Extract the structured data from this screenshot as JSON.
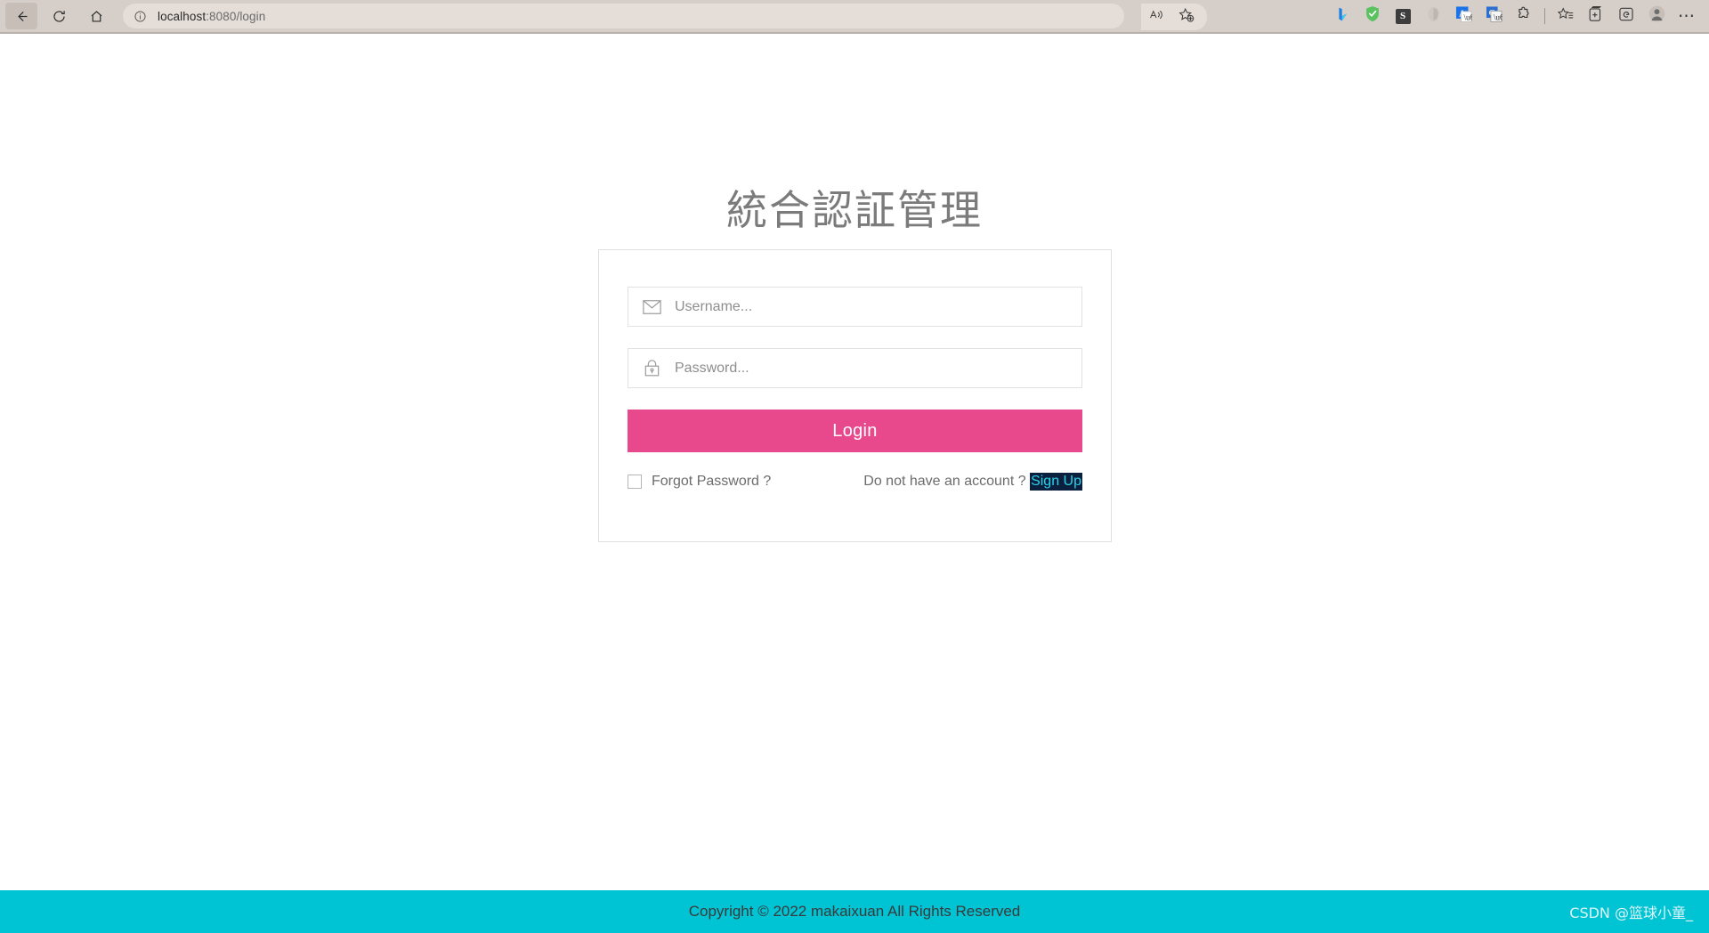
{
  "browser": {
    "nav": {
      "back_icon": "arrow-left-icon",
      "reload_icon": "reload-icon",
      "home_icon": "home-icon"
    },
    "omnibox": {
      "info_icon": "info-circle-icon",
      "url_host": "localhost",
      "url_rest": ":8080/login",
      "read_aloud_icon": "read-aloud-icon",
      "favorite_icon": "add-favorite-star-icon"
    },
    "toolbar_icons": [
      {
        "name": "bing-copilot-icon",
        "glyph": "b",
        "color": "#1e6fd9"
      },
      {
        "name": "adguard-shield-icon",
        "glyph": "✓",
        "color": "#4ec45a"
      },
      {
        "name": "sider-extension-icon",
        "glyph": "S",
        "color": "#3c3c3c"
      },
      {
        "name": "grammarly-extension-icon",
        "glyph": "",
        "color": "#b9b3ad"
      },
      {
        "name": "translate-a-extension-icon",
        "glyph": "A",
        "color": "#1a73e8"
      },
      {
        "name": "google-translate-extension-icon",
        "glyph": "G",
        "color": "#1a73e8"
      },
      {
        "name": "extensions-puzzle-icon",
        "glyph": "",
        "color": "#3a3a3a"
      },
      {
        "name": "favorites-list-icon",
        "glyph": "",
        "color": "#3a3a3a"
      },
      {
        "name": "collections-icon",
        "glyph": "",
        "color": "#3a3a3a"
      },
      {
        "name": "browser-essentials-icon",
        "glyph": "e",
        "color": "#3a3a3a"
      },
      {
        "name": "profile-avatar-icon",
        "glyph": "",
        "color": "#6b6b6b"
      },
      {
        "name": "settings-and-more-icon",
        "glyph": "…",
        "color": "#3a3a3a"
      }
    ]
  },
  "page": {
    "title": "統合認証管理",
    "form": {
      "username": {
        "icon": "envelope-icon",
        "placeholder": "Username...",
        "value": ""
      },
      "password": {
        "icon": "lock-icon",
        "placeholder": "Password...",
        "value": ""
      },
      "login_label": "Login",
      "forgot_label": "Forgot Password ?",
      "forgot_checked": false,
      "signup_prompt": "Do not have an account ?",
      "signup_label": "Sign Up"
    },
    "colors": {
      "login_button": "#e8488c",
      "footer": "#00c4d4",
      "title_text": "#7b7b7b",
      "signup_highlight_bg": "#0b1f3f",
      "signup_highlight_text": "#29d3e8"
    }
  },
  "footer": {
    "copyright": "Copyright © 2022 makaixuan All Rights Reserved",
    "watermark": "CSDN @篮球小童_"
  }
}
